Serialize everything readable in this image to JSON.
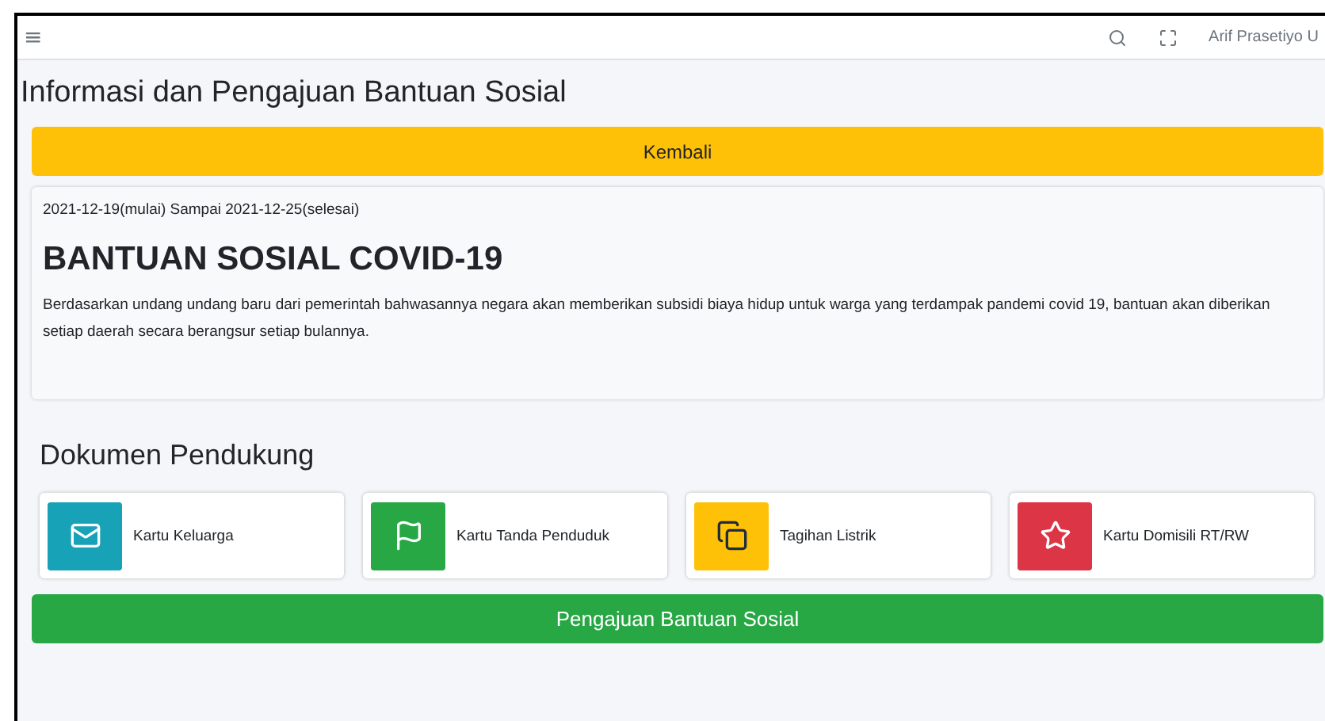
{
  "navbar": {
    "menu_glyph": "≡",
    "user": "Arif Prasetiyo U"
  },
  "page_title": "Informasi dan Pengajuan Bantuan Sosial",
  "back_button": "Kembali",
  "program": {
    "period": "2021-12-19(mulai) Sampai 2021-12-25(selesai)",
    "title": "BANTUAN SOSIAL COVID-19",
    "description": "Berdasarkan undang undang baru dari pemerintah bahwasannya negara akan memberikan subsidi biaya hidup untuk warga yang terdampak pandemi covid 19, bantuan akan diberikan setiap daerah secara berangsur setiap bulannya."
  },
  "documents_title": "Dokumen Pendukung",
  "documents": [
    {
      "label": "Kartu Keluarga",
      "color": "#17a2b8"
    },
    {
      "label": "Kartu Tanda Penduduk",
      "color": "#28a745"
    },
    {
      "label": "Tagihan Listrik",
      "color": "#ffc107"
    },
    {
      "label": "Kartu Domisili RT/RW",
      "color": "#dc3545"
    }
  ],
  "submit_button": "Pengajuan Bantuan Sosial"
}
